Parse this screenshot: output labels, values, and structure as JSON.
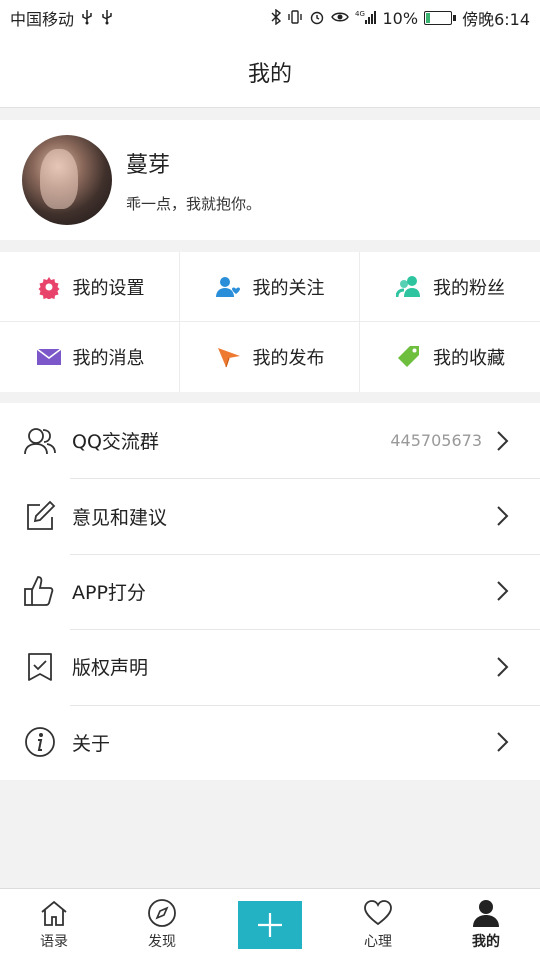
{
  "status_bar": {
    "carrier": "中国移动",
    "battery": "10%",
    "time": "傍晚6:14",
    "battery_level": 0.1
  },
  "header": {
    "title": "我的"
  },
  "profile": {
    "name": "蔓芽",
    "signature": "乖一点，我就抱你。"
  },
  "grid": [
    {
      "label": "我的设置",
      "icon": "gear-icon",
      "color": "#e8446b"
    },
    {
      "label": "我的关注",
      "icon": "user-heart-icon",
      "color": "#2a8fd8"
    },
    {
      "label": "我的粉丝",
      "icon": "users-icon",
      "color": "#2ec4a0"
    },
    {
      "label": "我的消息",
      "icon": "envelope-icon",
      "color": "#7b57c9"
    },
    {
      "label": "我的发布",
      "icon": "paper-plane-icon",
      "color": "#ee7a32"
    },
    {
      "label": "我的收藏",
      "icon": "tag-icon",
      "color": "#6fbf3f"
    }
  ],
  "list": [
    {
      "label": "QQ交流群",
      "value": "445705673",
      "icon": "chat-users-icon"
    },
    {
      "label": "意见和建议",
      "value": "",
      "icon": "edit-icon"
    },
    {
      "label": "APP打分",
      "value": "",
      "icon": "thumbs-up-icon"
    },
    {
      "label": "版权声明",
      "value": "",
      "icon": "bookmark-check-icon"
    },
    {
      "label": "关于",
      "value": "",
      "icon": "info-icon"
    }
  ],
  "tabbar": [
    {
      "label": "语录",
      "icon": "home-icon"
    },
    {
      "label": "发现",
      "icon": "compass-icon"
    },
    {
      "label": "",
      "icon": "plus-icon"
    },
    {
      "label": "心理",
      "icon": "heart-icon"
    },
    {
      "label": "我的",
      "icon": "person-icon",
      "active": true
    }
  ],
  "colors": {
    "accent": "#22b2c4"
  }
}
